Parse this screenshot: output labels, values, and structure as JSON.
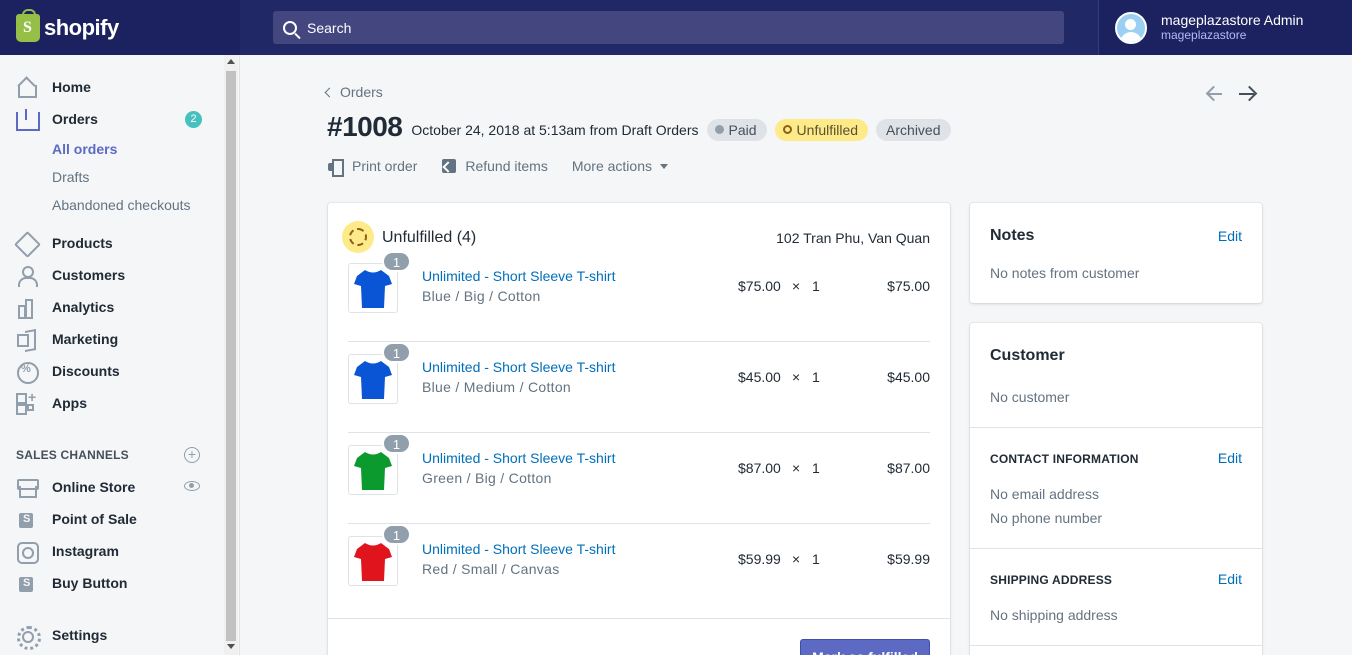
{
  "brand": {
    "name": "shopify",
    "color": "#95bf47"
  },
  "search": {
    "placeholder": "Search"
  },
  "user": {
    "name": "mageplazastore Admin",
    "store": "mageplazastore"
  },
  "sidebar": {
    "items": [
      {
        "label": "Home",
        "icon": "home-icon"
      },
      {
        "label": "Orders",
        "icon": "orders-icon",
        "badge": "2"
      },
      {
        "label": "Products",
        "icon": "tag-icon"
      },
      {
        "label": "Customers",
        "icon": "person-icon"
      },
      {
        "label": "Analytics",
        "icon": "bar-chart-icon"
      },
      {
        "label": "Marketing",
        "icon": "megaphone-icon"
      },
      {
        "label": "Discounts",
        "icon": "discount-icon"
      },
      {
        "label": "Apps",
        "icon": "apps-icon"
      }
    ],
    "orders_sub": [
      "All orders",
      "Drafts",
      "Abandoned checkouts"
    ],
    "sales_channels_heading": "SALES CHANNELS",
    "channels": [
      {
        "label": "Online Store",
        "icon": "store-icon"
      },
      {
        "label": "Point of Sale",
        "icon": "shopify-bag-icon"
      },
      {
        "label": "Instagram",
        "icon": "instagram-icon"
      },
      {
        "label": "Buy Button",
        "icon": "shopify-bag-icon"
      }
    ],
    "settings": "Settings"
  },
  "page": {
    "back_label": "Orders",
    "order_number": "#1008",
    "order_date": "October 24, 2018 at 5:13am from Draft Orders",
    "badges": {
      "paid": "Paid",
      "unfulfilled": "Unfulfilled",
      "archived": "Archived"
    },
    "actions": {
      "print": "Print order",
      "refund": "Refund items",
      "more": "More actions"
    }
  },
  "fulfillment": {
    "title": "Unfulfilled (4)",
    "address": "102 Tran Phu, Van Quan",
    "button": "Mark as fulfilled",
    "lines": [
      {
        "name": "Unlimited - Short Sleeve T-shirt",
        "variant": "Blue / Big / Cotton",
        "price": "$75.00",
        "times": "×",
        "qty": "1",
        "total": "$75.00",
        "badge": "1",
        "color": "#0a55d6"
      },
      {
        "name": "Unlimited - Short Sleeve T-shirt",
        "variant": "Blue / Medium / Cotton",
        "price": "$45.00",
        "times": "×",
        "qty": "1",
        "total": "$45.00",
        "badge": "1",
        "color": "#0a55d6"
      },
      {
        "name": "Unlimited - Short Sleeve T-shirt",
        "variant": "Green / Big / Cotton",
        "price": "$87.00",
        "times": "×",
        "qty": "1",
        "total": "$87.00",
        "badge": "1",
        "color": "#0b9a2e"
      },
      {
        "name": "Unlimited - Short Sleeve T-shirt",
        "variant": "Red / Small / Canvas",
        "price": "$59.99",
        "times": "×",
        "qty": "1",
        "total": "$59.99",
        "badge": "1",
        "color": "#e0141c"
      }
    ]
  },
  "notes": {
    "title": "Notes",
    "edit": "Edit",
    "text": "No notes from customer"
  },
  "customer": {
    "title": "Customer",
    "text": "No customer",
    "contact_heading": "CONTACT INFORMATION",
    "contact_edit": "Edit",
    "email": "No email address",
    "phone": "No phone number",
    "shipping_heading": "SHIPPING ADDRESS",
    "shipping_edit": "Edit",
    "shipping": "No shipping address"
  }
}
